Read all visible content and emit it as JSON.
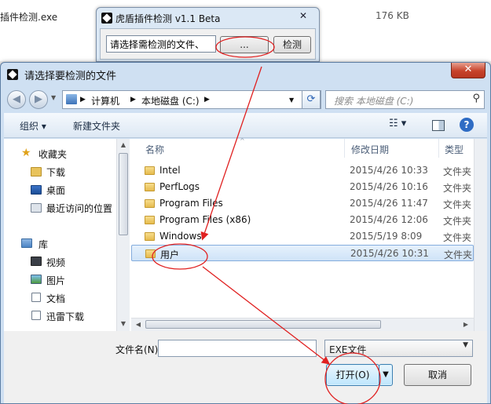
{
  "background": {
    "file_name": "插件检测.exe",
    "file_size": "176 KB"
  },
  "checker_window": {
    "title": "虎盾插件检测 v1.1 Beta",
    "close_label": "✕",
    "path_input_value": "请选择需检测的文件、",
    "browse_label": "...",
    "check_label": "检测"
  },
  "dialog": {
    "title": "请选择要检测的文件",
    "close_label": "✕",
    "breadcrumbs": [
      "计算机",
      "本地磁盘 (C:)"
    ],
    "search_placeholder": "搜索 本地磁盘 (C:)",
    "toolbar": {
      "organize_label": "组织 ▾",
      "new_folder_label": "新建文件夹"
    },
    "nav": {
      "favorites_label": "收藏夹",
      "downloads_label": "下载",
      "desktop_label": "桌面",
      "recent_label": "最近访问的位置",
      "libraries_label": "库",
      "videos_label": "视频",
      "pictures_label": "图片",
      "documents_label": "文档",
      "thunder_label": "迅雷下载"
    },
    "columns": {
      "name": "名称",
      "date": "修改日期",
      "type": "类型"
    },
    "files": [
      {
        "name": "Intel",
        "date": "2015/4/26 10:33",
        "type": "文件夹"
      },
      {
        "name": "PerfLogs",
        "date": "2015/4/26 10:16",
        "type": "文件夹"
      },
      {
        "name": "Program Files",
        "date": "2015/4/26 11:47",
        "type": "文件夹"
      },
      {
        "name": "Program Files (x86)",
        "date": "2015/4/26 12:06",
        "type": "文件夹"
      },
      {
        "name": "Windows",
        "date": "2015/5/19 8:09",
        "type": "文件夹"
      },
      {
        "name": "用户",
        "date": "2015/4/26 10:31",
        "type": "文件夹"
      }
    ],
    "selected_index": 5,
    "filename_label": "文件名(N):",
    "filename_value": "",
    "filetype_value": "EXE文件",
    "open_label": "打开(O)",
    "cancel_label": "取消"
  },
  "colors": {
    "annotation": "#e02020",
    "selection": "#cfe3f8"
  }
}
